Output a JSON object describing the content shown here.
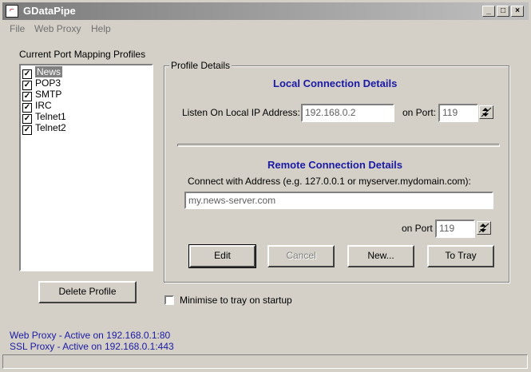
{
  "window": {
    "title": "GDataPipe",
    "icon": "app-icon",
    "controls": {
      "minimize": "_",
      "maximize": "□",
      "close": "×"
    }
  },
  "menu": {
    "items": [
      "File",
      "Web Proxy",
      "Help"
    ]
  },
  "profiles": {
    "label": "Current Port Mapping Profiles",
    "items": [
      {
        "name": "News",
        "checked": true,
        "selected": true
      },
      {
        "name": "POP3",
        "checked": true
      },
      {
        "name": "SMTP",
        "checked": true
      },
      {
        "name": "IRC",
        "checked": true
      },
      {
        "name": "Telnet1",
        "checked": true
      },
      {
        "name": "Telnet2",
        "checked": true
      }
    ],
    "delete_button": "Delete Profile"
  },
  "details": {
    "group_label": "Profile Details",
    "local": {
      "heading": "Local Connection Details",
      "listen_label": "Listen On Local IP Address:",
      "ip_value": "192.168.0.2",
      "port_label": "on Port:",
      "port_value": "119"
    },
    "remote": {
      "heading": "Remote Connection Details",
      "connect_label": "Connect with Address (e.g. 127.0.0.1 or myserver.mydomain.com):",
      "address_value": "my.news-server.com",
      "port_label": "on Port",
      "port_value": "119"
    },
    "buttons": {
      "edit": "Edit",
      "cancel": "Cancel",
      "new": "New...",
      "to_tray": "To Tray"
    }
  },
  "minimise": {
    "label": "Minimise to tray on startup",
    "checked": false
  },
  "status": {
    "web_proxy": "Web Proxy - Active on 192.168.0.1:80",
    "ssl_proxy": "SSL Proxy - Active on 192.168.0.1:443"
  },
  "colors": {
    "accent_blue": "#1a1aa6",
    "title_gradient_start": "#7b7b7b"
  }
}
